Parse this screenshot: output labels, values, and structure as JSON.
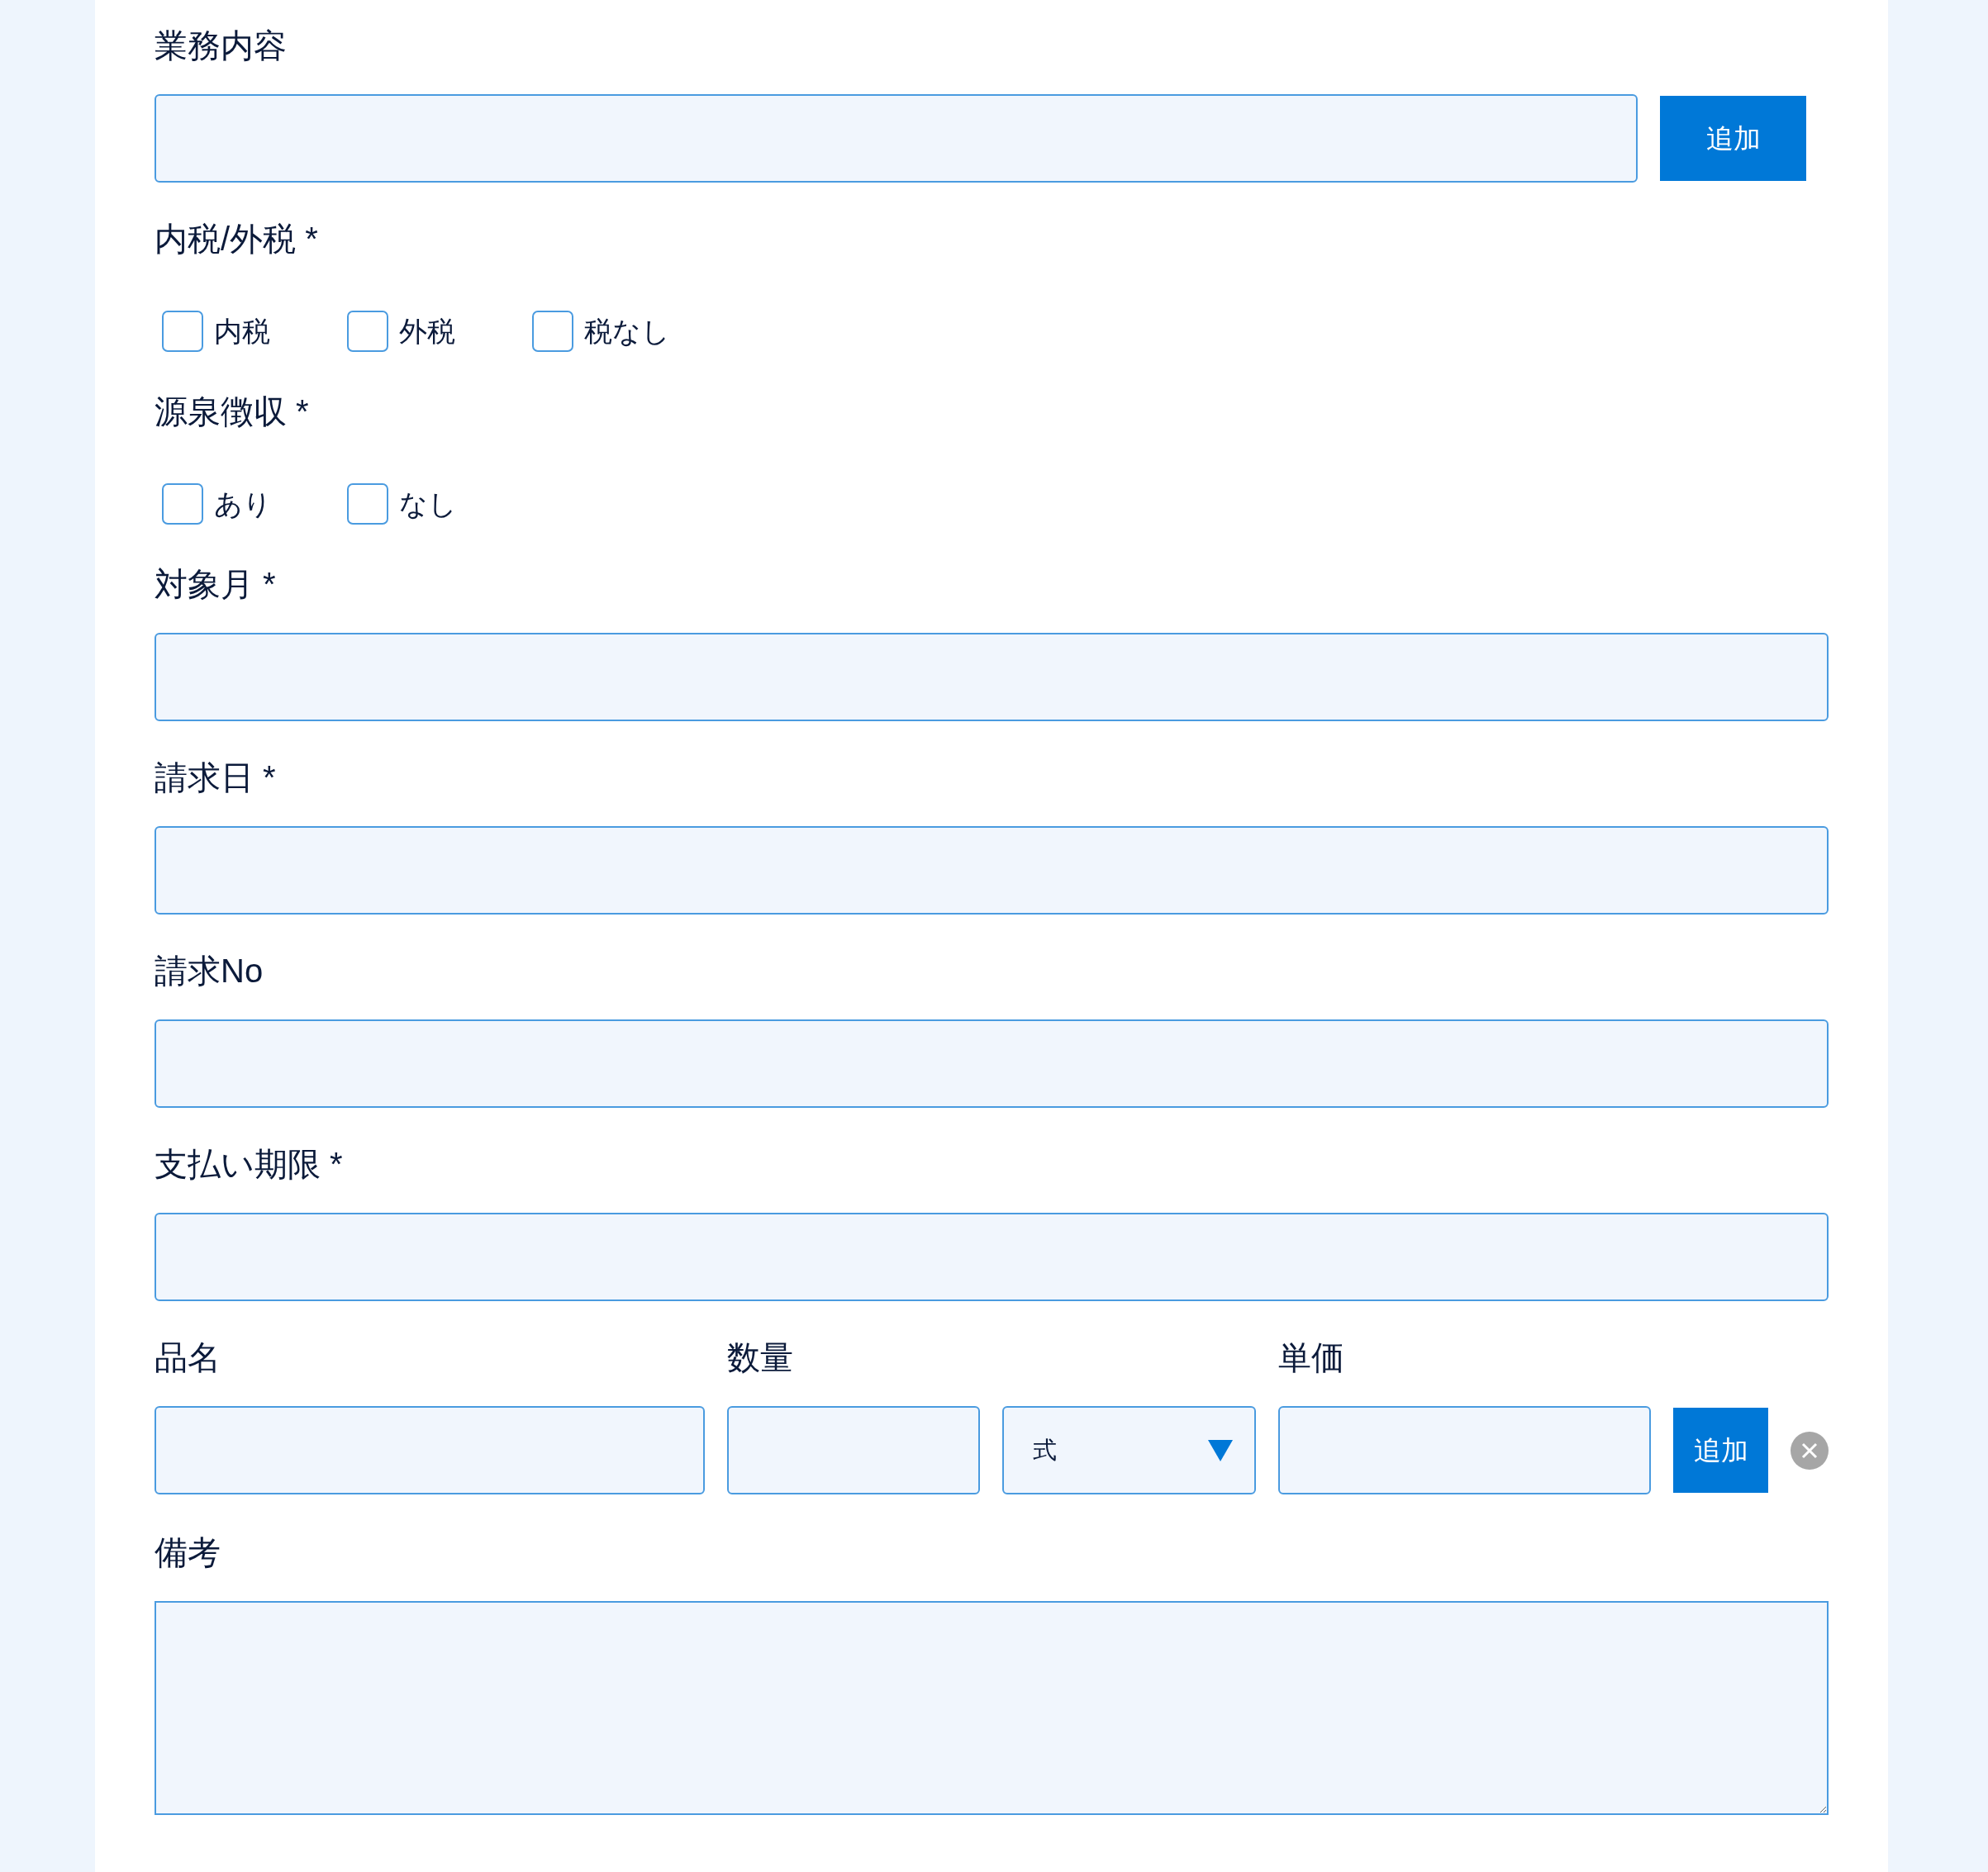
{
  "fields": [
    {
      "kind": "text_with_button",
      "label": "業務内容",
      "button": "追加"
    },
    {
      "kind": "checkboxes",
      "label": "内税/外税 *",
      "options": [
        {
          "label": "内税",
          "checked": false
        },
        {
          "label": "外税",
          "checked": false
        },
        {
          "label": "税なし",
          "checked": false
        }
      ]
    },
    {
      "kind": "checkboxes",
      "label": "源泉徴収 *",
      "options": [
        {
          "label": "あり",
          "checked": false
        },
        {
          "label": "なし",
          "checked": false
        }
      ]
    },
    {
      "kind": "text",
      "label": "対象月 *"
    },
    {
      "kind": "text",
      "label": "請求日 *"
    },
    {
      "kind": "text",
      "label": "請求No"
    },
    {
      "kind": "text",
      "label": "支払い期限 *"
    }
  ],
  "item_row": {
    "name_label": "品名",
    "quantity_label": "数量",
    "unit_price_label": "単価",
    "unit": "式",
    "button": "追加"
  },
  "remarks": {
    "label": "備考"
  }
}
